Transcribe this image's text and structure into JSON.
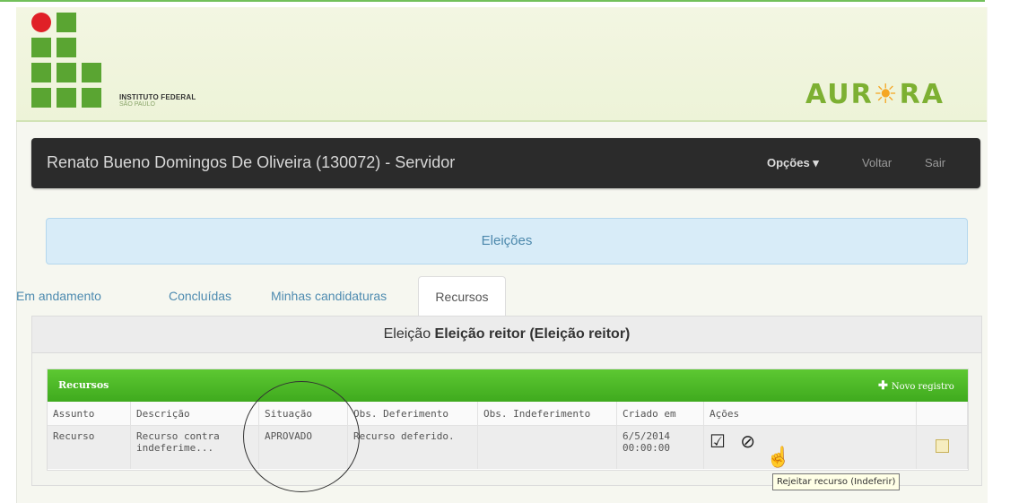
{
  "header": {
    "institution_line1": "INSTITUTO FEDERAL",
    "institution_line2": "SÃO PAULO",
    "brand": "AURORA",
    "brand_colors": {
      "green": "#5aa532",
      "red": "#e02027",
      "orange": "#f5a623"
    }
  },
  "navbar": {
    "user": "Renato Bueno Domingos De Oliveira (130072) - Servidor",
    "options": "Opções ▾",
    "back": "Voltar",
    "exit": "Sair"
  },
  "banner": {
    "title": "Eleições"
  },
  "tabs": [
    {
      "label": "Em andamento"
    },
    {
      "label": "Concluídas"
    },
    {
      "label": "Minhas candidaturas"
    },
    {
      "label": "Recursos",
      "active": true
    }
  ],
  "panel": {
    "title_prefix": "Eleição ",
    "title_bold": "Eleição reitor (Eleição reitor)"
  },
  "recursos": {
    "title": "Recursos",
    "new_record": "Novo registro",
    "columns": [
      "Assunto",
      "Descrição",
      "Situação",
      "Obs. Deferimento",
      "Obs. Indeferimento",
      "Criado em",
      "Ações"
    ],
    "rows": [
      {
        "assunto": "Recurso",
        "descricao_l1": "Recurso contra",
        "descricao_l2": "indeferime...",
        "situacao": "APROVADO",
        "obs_deferimento": "Recurso deferido.",
        "obs_indeferimento": "",
        "criado_l1": "6/5/2014",
        "criado_l2": "00:00:00",
        "acoes_icons": [
          "approve-check-icon",
          "reject-ban-icon"
        ]
      }
    ]
  },
  "tooltip": "Rejeitar recurso (Indeferir)"
}
